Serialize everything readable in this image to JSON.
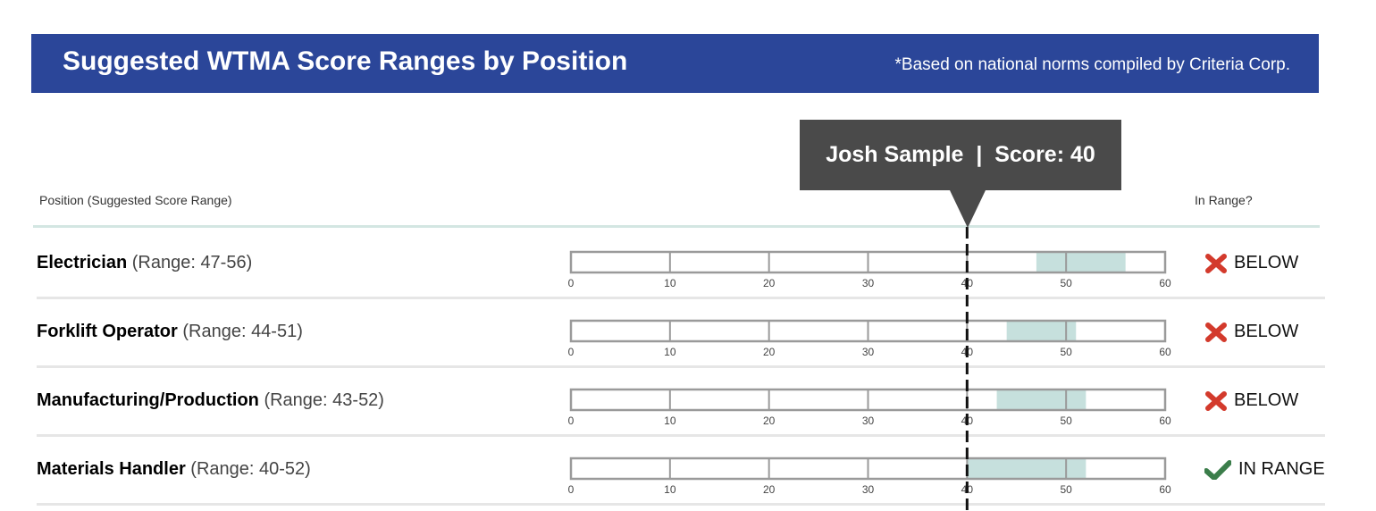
{
  "header": {
    "title": "Suggested WTMA Score Ranges by Position",
    "note": "*Based on national norms compiled by Criteria Corp.",
    "background_color": "#2B4699"
  },
  "columns": {
    "position": "Position (Suggested Score Range)",
    "in_range": "In Range?"
  },
  "tooltip": {
    "text": "Josh Sample  |  Score: 40"
  },
  "chart_data": {
    "type": "range-bar",
    "title": "Suggested WTMA Score Ranges by Position",
    "candidate": {
      "name": "Josh Sample",
      "score": 40
    },
    "xlim": [
      0,
      60
    ],
    "ticks": [
      "0",
      "10",
      "20",
      "30",
      "40",
      "50",
      "60"
    ],
    "range_color": "#c6e0dd",
    "rows": [
      {
        "position": "Electrician",
        "range_label": "(Range: 47-56)",
        "min": 47,
        "max": 56,
        "status": "BELOW",
        "status_icon": "x-icon"
      },
      {
        "position": "Forklift Operator",
        "range_label": "(Range: 44-51)",
        "min": 44,
        "max": 51,
        "status": "BELOW",
        "status_icon": "x-icon"
      },
      {
        "position": "Manufacturing/Production",
        "range_label": "(Range: 43-52)",
        "min": 43,
        "max": 52,
        "status": "BELOW",
        "status_icon": "x-icon"
      },
      {
        "position": "Materials Handler",
        "range_label": "(Range: 40-52)",
        "min": 40,
        "max": 52,
        "status": "IN RANGE",
        "status_icon": "check-icon"
      }
    ]
  },
  "status_colors": {
    "below": "#d33a2c",
    "in_range": "#3b7d4a"
  }
}
